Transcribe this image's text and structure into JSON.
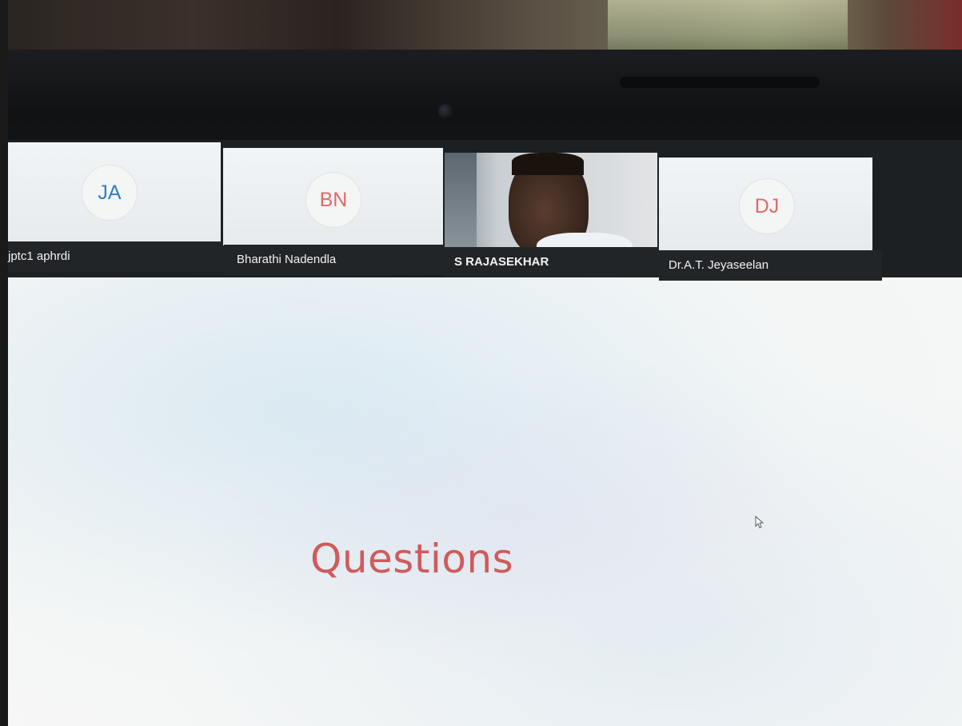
{
  "participants": [
    {
      "initials": "JA",
      "name": "jptc1 aphrdi",
      "initials_color": "#2f7fc4",
      "has_video": false
    },
    {
      "initials": "BN",
      "name": "Bharathi Nadendla",
      "initials_color": "#e06a6a",
      "has_video": false
    },
    {
      "initials": "",
      "name": "S RAJASEKHAR",
      "initials_color": "",
      "has_video": true
    },
    {
      "initials": "DJ",
      "name": "Dr.A.T. Jeyaseelan",
      "initials_color": "#e06a6a",
      "has_video": false
    }
  ],
  "slide": {
    "title": "Questions",
    "title_color": "#cf5b5b"
  },
  "cursor": {
    "icon": "mouse-pointer-icon"
  }
}
